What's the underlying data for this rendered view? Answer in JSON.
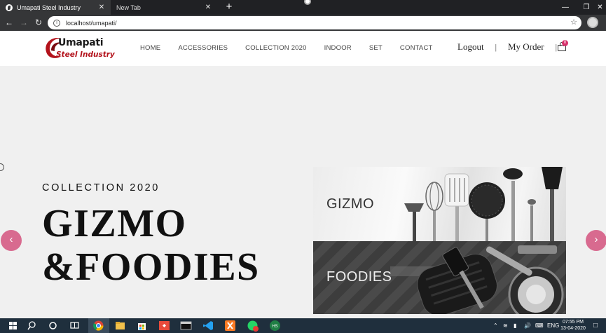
{
  "browser": {
    "tabs": [
      {
        "title": "Umapati Steel Industry",
        "active": true
      },
      {
        "title": "New Tab",
        "active": false
      }
    ],
    "url": "localhost/umapati/",
    "new_tab_symbol": "+",
    "close_symbol": "✕"
  },
  "site": {
    "logo": {
      "line1": "Umapati",
      "line2": "Steel Industry"
    },
    "nav": [
      "HOME",
      "ACCESSORIES",
      "COLLECTION 2020",
      "INDOOR",
      "SET",
      "CONTACT"
    ],
    "account": {
      "logout": "Logout",
      "separator": "|",
      "my_order": "My Order"
    },
    "cart_count": "0"
  },
  "hero": {
    "subtitle": "COLLECTION 2020",
    "title_line1": "GIZMO",
    "title_line2": "&FOODIES",
    "prev_symbol": "‹",
    "next_symbol": "›",
    "banners": [
      {
        "label": "GIZMO"
      },
      {
        "label": "FOODIES"
      }
    ]
  },
  "taskbar": {
    "language": "ENG",
    "time": "07:55 PM",
    "date": "13-04-2020",
    "pinned": [
      "windows-icon",
      "search-icon",
      "cortana-icon",
      "task-view-icon",
      "chrome-icon",
      "file-explorer-icon",
      "store-icon",
      "anydesk-icon",
      "terminal-icon",
      "vscode-icon",
      "xampp-icon",
      "whatsapp-icon",
      "hs-icon"
    ]
  },
  "colors": {
    "accent_pink": "#d86a8f",
    "logo_red": "#b3121b",
    "taskbar": "#1f2f3d"
  }
}
